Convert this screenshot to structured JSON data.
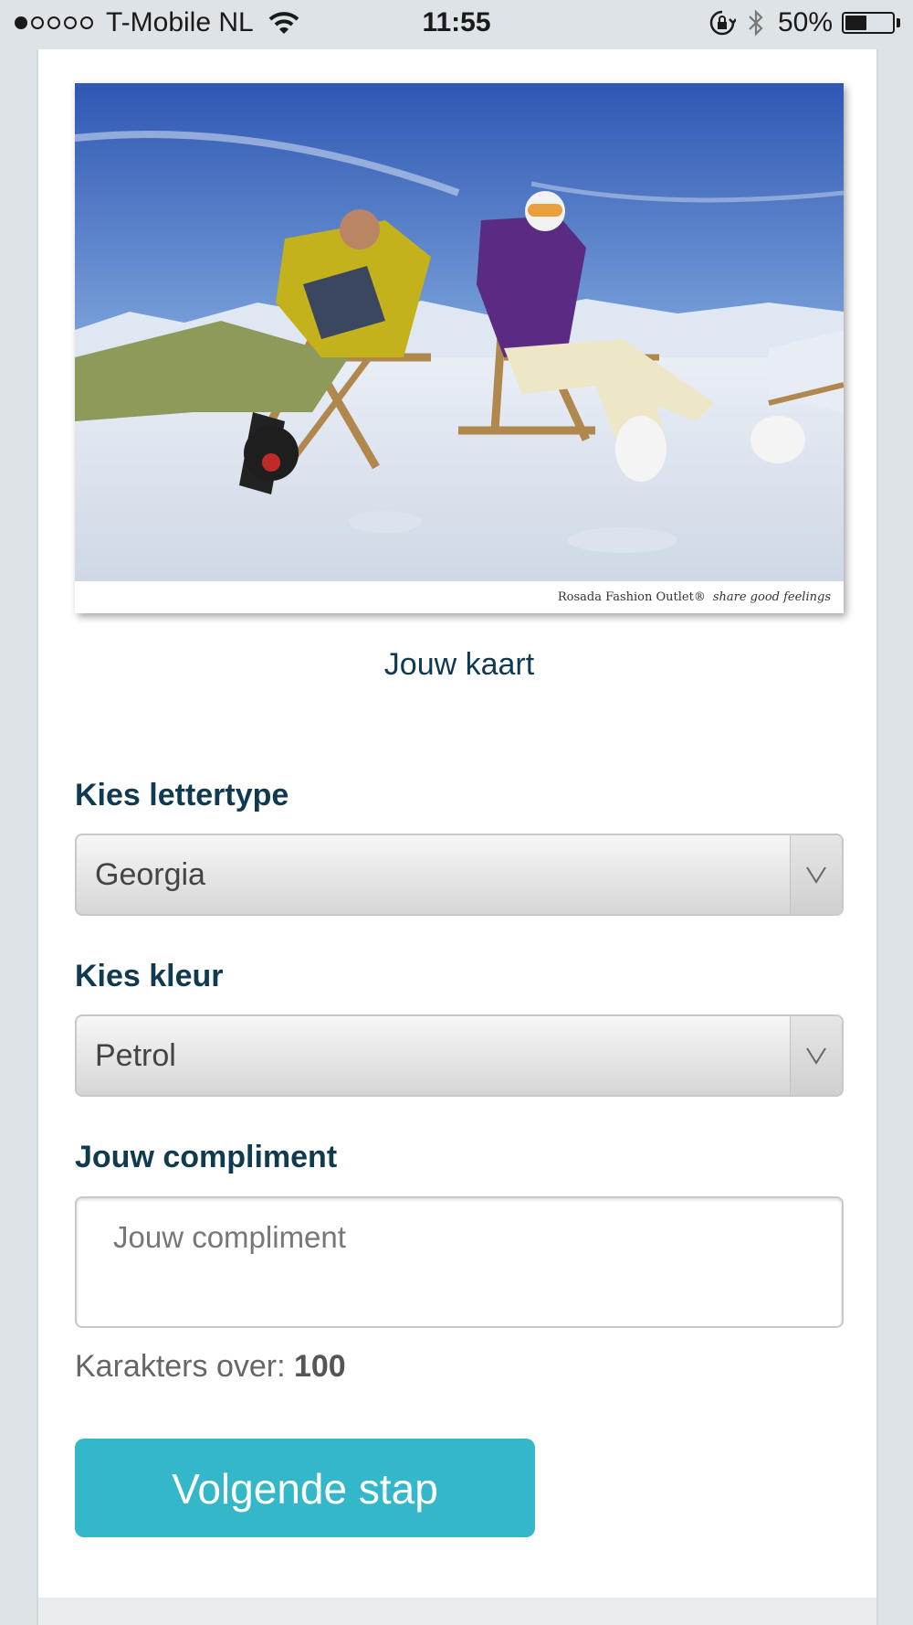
{
  "status_bar": {
    "carrier": "T-Mobile NL",
    "signal_bars_filled": 1,
    "signal_bars_total": 5,
    "time": "11:55",
    "battery_percent": "50%",
    "battery_level": 0.5
  },
  "card_preview": {
    "brand_text": "Rosada Fashion Outlet®",
    "tagline": "share good feelings",
    "caption": "Jouw kaart"
  },
  "form": {
    "font_label": "Kies lettertype",
    "font_value": "Georgia",
    "color_label": "Kies kleur",
    "color_value": "Petrol",
    "compliment_label": "Jouw compliment",
    "compliment_placeholder": "Jouw compliment",
    "chars_left_label": "Karakters over:",
    "chars_left_value": "100",
    "next_button": "Volgende stap"
  },
  "colors": {
    "heading": "#0f3a4f",
    "button": "#33b7c9",
    "page_background": "#dde3e6"
  },
  "icons": [
    "wifi-icon",
    "orientation-lock-icon",
    "bluetooth-icon",
    "battery-icon",
    "chevron-down-icon"
  ]
}
